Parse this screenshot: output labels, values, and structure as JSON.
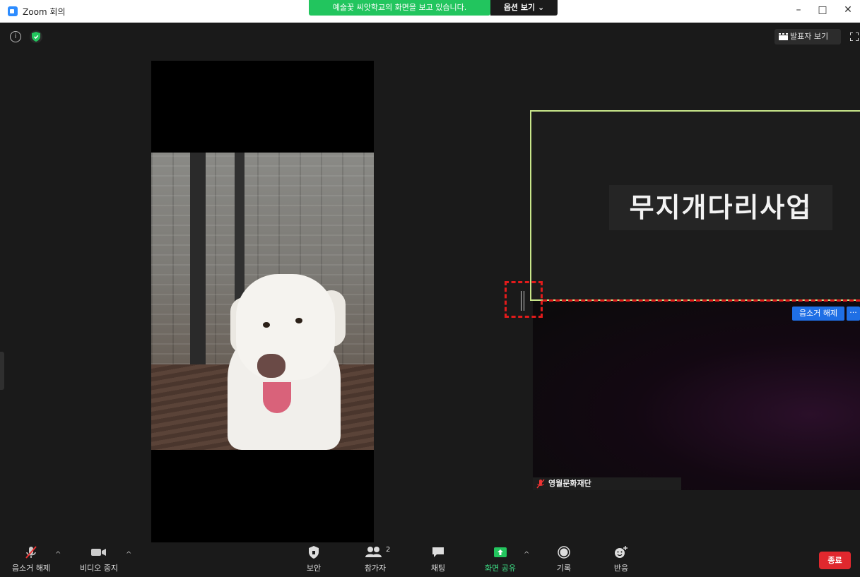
{
  "window": {
    "title": "Zoom 회의",
    "minimize": "–",
    "maximize": "□",
    "close": "✕"
  },
  "banner": {
    "sharing_text": "예술꽃 씨앗학교의 화면을 보고 있습니다.",
    "view_options": "옵션 보기 ⌄"
  },
  "top_overlay": {
    "info": "i",
    "speaker_view": "발표자 보기"
  },
  "active_speaker": {
    "name": "무지개다리사업"
  },
  "second_participant": {
    "unmute_label": "음소거 해제",
    "more_label": "···",
    "name": "영월문화재단"
  },
  "toolbar": {
    "unmute": "음소거 해제",
    "stop_video": "비디오 중지",
    "security": "보안",
    "participants": "참가자",
    "participants_count": "2",
    "chat": "채팅",
    "share_screen": "화면 공유",
    "record": "기록",
    "reactions": "반응",
    "end": "종료",
    "caret": "^"
  },
  "colors": {
    "share_green": "#22c55e",
    "active_border": "#c8e68a",
    "zoom_blue": "#1f6fe5",
    "end_red": "#e0282e",
    "annotation_red": "#e21b1b"
  }
}
